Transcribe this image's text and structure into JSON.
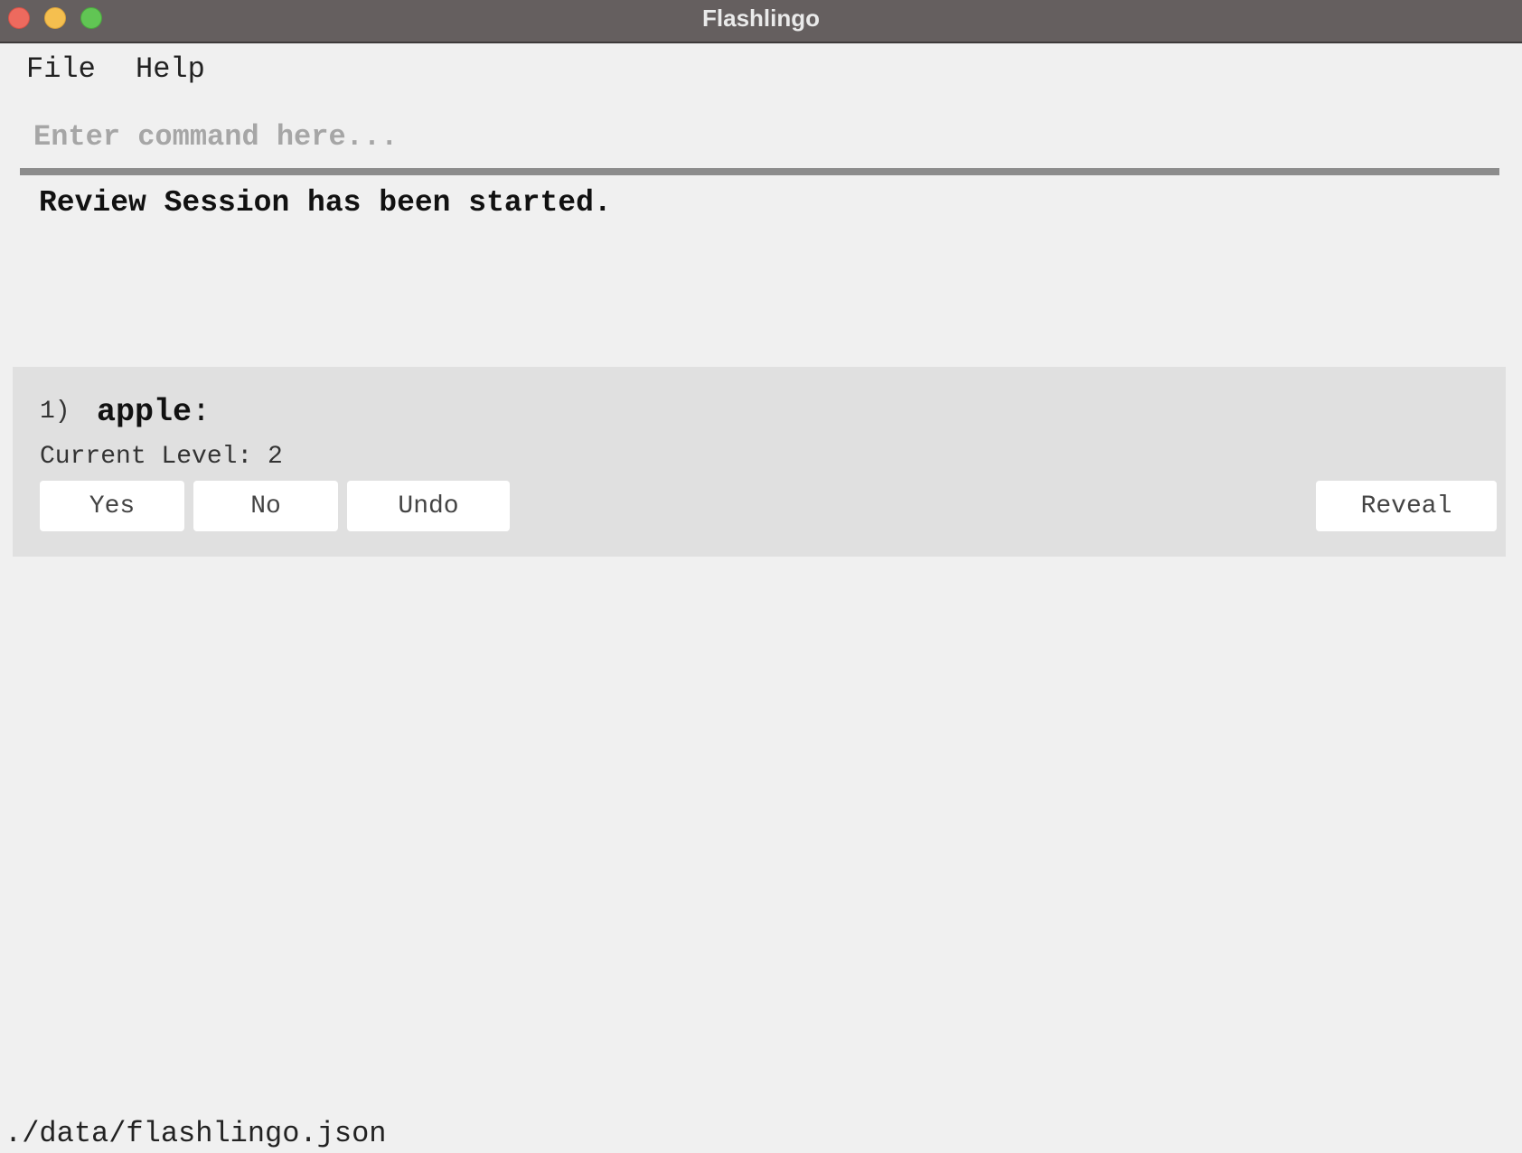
{
  "window": {
    "title": "Flashlingo"
  },
  "menu": {
    "file": "File",
    "help": "Help"
  },
  "command": {
    "placeholder": "Enter command here...",
    "value": ""
  },
  "result": {
    "message": "Review Session has been started."
  },
  "card": {
    "index": "1)",
    "word": "apple",
    "colon": ":",
    "level_text": "Current Level: 2",
    "buttons": {
      "yes": "Yes",
      "no": "No",
      "undo": "Undo",
      "reveal": "Reveal"
    }
  },
  "status": {
    "file_path": "./data/flashlingo.json"
  },
  "colors": {
    "titlebar": "#655f5f",
    "background": "#f0f0f0",
    "card_background": "#e0e0e0",
    "close": "#ed6a5e",
    "minimize": "#f5bf4f",
    "zoom": "#61c554"
  },
  "icons": [
    "close-icon",
    "minimize-icon",
    "zoom-icon"
  ]
}
